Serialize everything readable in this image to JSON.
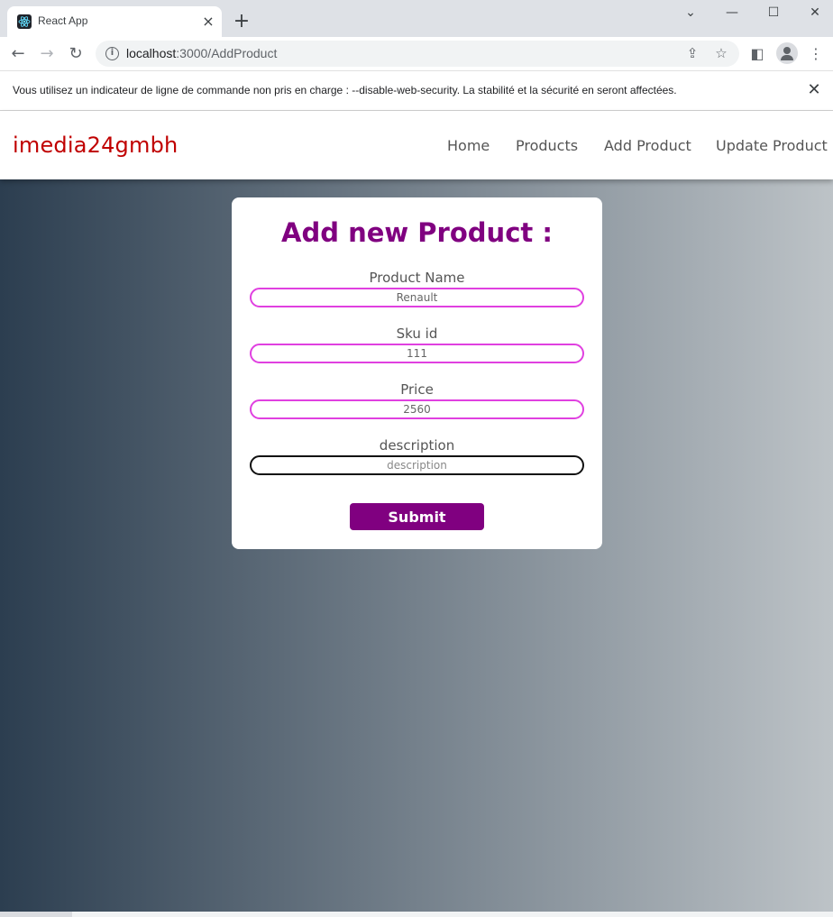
{
  "browser": {
    "tab_title": "React App",
    "tab_close": "×",
    "new_tab": "+",
    "minimize": "—",
    "maximize": "☐",
    "close_window": "✕",
    "collapse": "⌄",
    "back": "←",
    "forward": "→",
    "reload": "↻",
    "info": "i",
    "url_host": "localhost",
    "url_path": ":3000/AddProduct",
    "share": "⇪",
    "bookmark": "☆",
    "side_panel": "◧",
    "menu": "⋮"
  },
  "infobar": {
    "message": "Vous utilisez un indicateur de ligne de commande non pris en charge : --disable-web-security. La stabilité et la sécurité en seront affectées.",
    "close": "✕"
  },
  "header": {
    "brand": "imedia24gmbh",
    "nav": [
      "Home",
      "Products",
      "Add Product",
      "Update Product"
    ]
  },
  "form": {
    "title": "Add new Product :",
    "fields": [
      {
        "label": "Product Name",
        "value": "Renault"
      },
      {
        "label": "Sku id",
        "value": "111"
      },
      {
        "label": "Price",
        "value": "2560"
      },
      {
        "label": "description",
        "value": "",
        "placeholder": "description"
      }
    ],
    "submit_label": "Submit"
  },
  "colors": {
    "brand": "#c00000",
    "accent": "#800080",
    "input_border": "#e040e0",
    "gradient_start": "#2c3e50",
    "gradient_end": "#bdc3c7"
  }
}
